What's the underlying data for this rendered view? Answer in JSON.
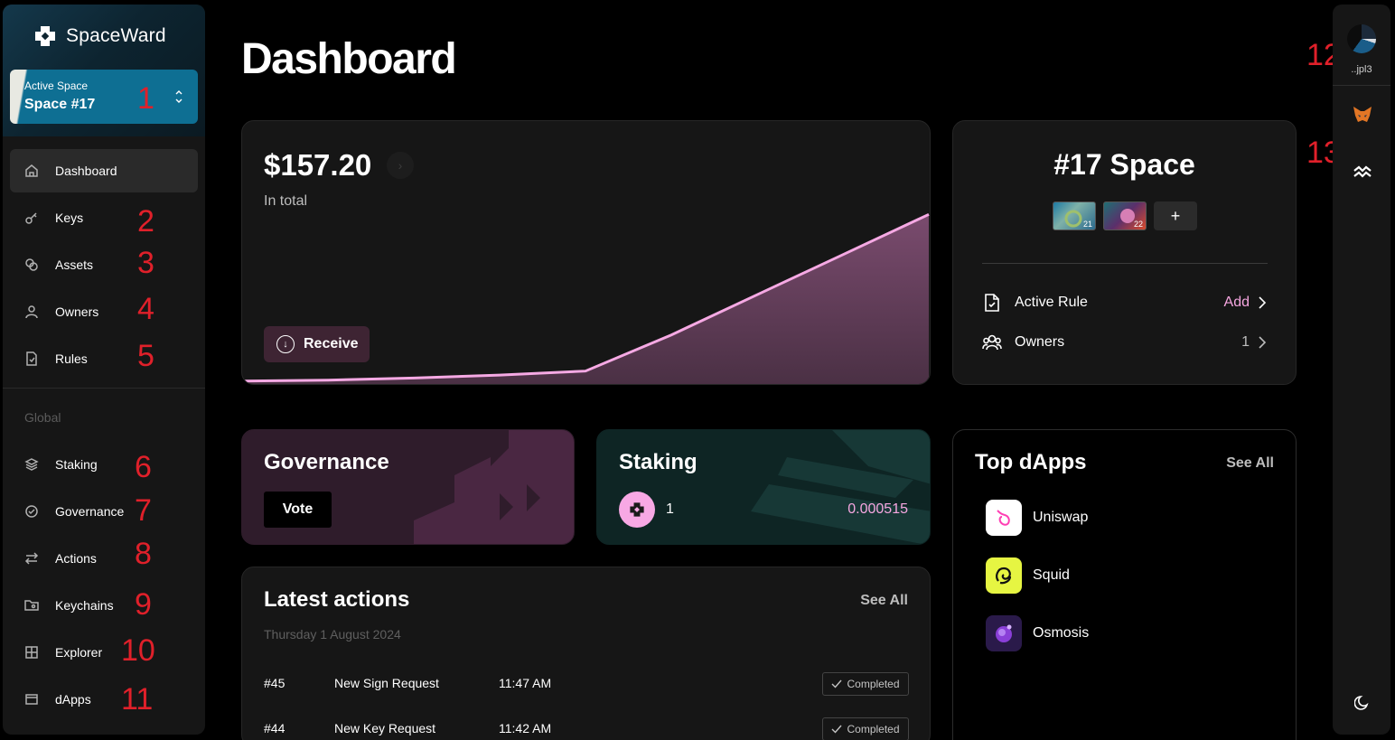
{
  "brand": {
    "name": "SpaceWard"
  },
  "space_selector": {
    "label": "Active Space",
    "value": "Space #17"
  },
  "nav": {
    "items": [
      {
        "label": "Dashboard"
      },
      {
        "label": "Keys"
      },
      {
        "label": "Assets"
      },
      {
        "label": "Owners"
      },
      {
        "label": "Rules"
      }
    ],
    "global_heading": "Global",
    "global_items": [
      {
        "label": "Staking"
      },
      {
        "label": "Governance"
      },
      {
        "label": "Actions"
      },
      {
        "label": "Keychains"
      },
      {
        "label": "Explorer"
      },
      {
        "label": "dApps"
      }
    ]
  },
  "annotations": [
    "1",
    "2",
    "3",
    "4",
    "5",
    "6",
    "7",
    "8",
    "9",
    "10",
    "11",
    "12",
    "13"
  ],
  "rail": {
    "account_label": "..jpl3"
  },
  "page": {
    "title": "Dashboard"
  },
  "balance": {
    "value": "$157.20",
    "label": "In total",
    "receive_label": "Receive"
  },
  "chart_data": {
    "type": "area",
    "title": "",
    "xlabel": "",
    "ylabel": "",
    "x": [
      0,
      1,
      2,
      3,
      4,
      5,
      6,
      7,
      8
    ],
    "values": [
      2,
      3,
      5,
      8,
      12,
      48,
      88,
      128,
      168
    ],
    "ylim": [
      0,
      180
    ],
    "grid": false,
    "line_color": "#f6a9e4",
    "fill_color": "#6a4460"
  },
  "space_card": {
    "title": "#17 Space",
    "keys": [
      {
        "number": "21"
      },
      {
        "number": "22"
      }
    ],
    "add_key": "+",
    "active_rule_label": "Active Rule",
    "active_rule_action": "Add",
    "owners_label": "Owners",
    "owners_count": "1"
  },
  "governance": {
    "title": "Governance",
    "vote_label": "Vote"
  },
  "staking": {
    "title": "Staking",
    "count": "1",
    "amount": "0.000515"
  },
  "latest_actions": {
    "title": "Latest actions",
    "see_all": "See All",
    "date": "Thursday 1 August 2024",
    "rows": [
      {
        "id": "#45",
        "name": "New Sign Request",
        "time": "11:47 AM",
        "status": "Completed"
      },
      {
        "id": "#44",
        "name": "New Key Request",
        "time": "11:42 AM",
        "status": "Completed"
      }
    ]
  },
  "top_dapps": {
    "title": "Top dApps",
    "see_all": "See All",
    "items": [
      {
        "name": "Uniswap",
        "icon": "uniswap-icon",
        "color": "#ffffff"
      },
      {
        "name": "Squid",
        "icon": "squid-icon",
        "color": "#e6f542"
      },
      {
        "name": "Osmosis",
        "icon": "osmosis-icon",
        "color": "#2a1a4a"
      }
    ]
  },
  "colors": {
    "accent_pink": "#f6a6e0",
    "annotation_red": "#e0202a"
  }
}
